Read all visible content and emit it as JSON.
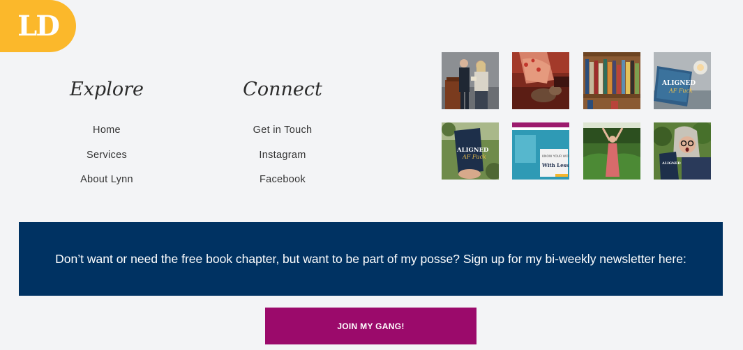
{
  "logo": {
    "text": "LD",
    "color": "#fbb82b"
  },
  "explore": {
    "heading": "Explore",
    "links": [
      "Home",
      "Services",
      "About Lynn"
    ]
  },
  "connect": {
    "heading": "Connect",
    "links": [
      "Get in Touch",
      "Instagram",
      "Facebook"
    ]
  },
  "gallery": {
    "images": [
      {
        "name": "photo-award-stage",
        "description": "two people on stage at a podium"
      },
      {
        "name": "photo-woman-with-dog",
        "description": "woman in floral dress with dog"
      },
      {
        "name": "photo-bookshelf",
        "description": "shelf of books"
      },
      {
        "name": "photo-book-on-table",
        "description": "Aligned AF book on a table"
      },
      {
        "name": "photo-book-in-hand",
        "description": "hand holding Aligned AF book outdoors"
      },
      {
        "name": "photo-book-page",
        "description": "teal book page With Less"
      },
      {
        "name": "photo-woman-in-field",
        "description": "woman with arms raised in green field"
      },
      {
        "name": "photo-woman-surprised",
        "description": "surprised woman holding book"
      }
    ]
  },
  "banner": {
    "text": "Don’t want or need the free book chapter, but want to be part of my posse? Sign up for my bi-weekly newsletter here:",
    "color": "#003262"
  },
  "cta": {
    "label": "JOIN MY GANG!",
    "color": "#9b0a6b"
  }
}
